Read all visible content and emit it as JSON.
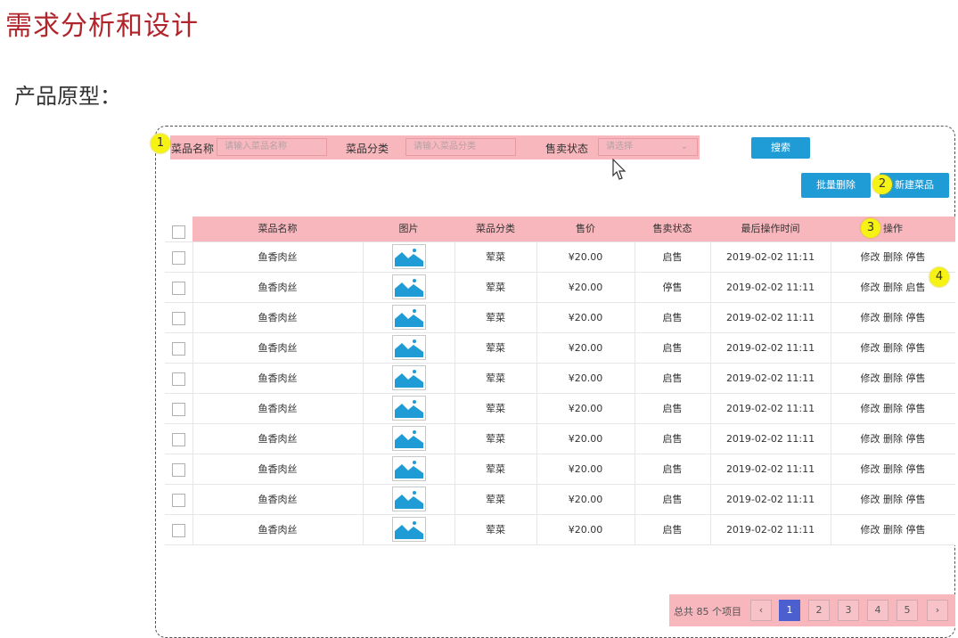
{
  "slide": {
    "title": "需求分析和设计",
    "subtitle": "产品原型："
  },
  "markers": [
    "1",
    "2",
    "3",
    "4"
  ],
  "search": {
    "name_label": "菜品名称",
    "name_placeholder": "请输入菜品名称",
    "category_label": "菜品分类",
    "category_placeholder": "请输入菜品分类",
    "status_label": "售卖状态",
    "status_placeholder": "请选择",
    "search_button": "搜索"
  },
  "actions": {
    "batch_delete": "批量删除",
    "new_dish": "新建菜品"
  },
  "table": {
    "columns": [
      "菜品名称",
      "图片",
      "菜品分类",
      "售价",
      "售卖状态",
      "最后操作时间",
      "操作"
    ],
    "rows": [
      {
        "name": "鱼香肉丝",
        "category": "荤菜",
        "price": "¥20.00",
        "status": "启售",
        "time": "2019-02-02 11:11",
        "edit": "修改",
        "delete": "删除",
        "toggle": "停售"
      },
      {
        "name": "鱼香肉丝",
        "category": "荤菜",
        "price": "¥20.00",
        "status": "停售",
        "time": "2019-02-02 11:11",
        "edit": "修改",
        "delete": "删除",
        "toggle": "启售"
      },
      {
        "name": "鱼香肉丝",
        "category": "荤菜",
        "price": "¥20.00",
        "status": "启售",
        "time": "2019-02-02 11:11",
        "edit": "修改",
        "delete": "删除",
        "toggle": "停售"
      },
      {
        "name": "鱼香肉丝",
        "category": "荤菜",
        "price": "¥20.00",
        "status": "启售",
        "time": "2019-02-02 11:11",
        "edit": "修改",
        "delete": "删除",
        "toggle": "停售"
      },
      {
        "name": "鱼香肉丝",
        "category": "荤菜",
        "price": "¥20.00",
        "status": "启售",
        "time": "2019-02-02 11:11",
        "edit": "修改",
        "delete": "删除",
        "toggle": "停售"
      },
      {
        "name": "鱼香肉丝",
        "category": "荤菜",
        "price": "¥20.00",
        "status": "启售",
        "time": "2019-02-02 11:11",
        "edit": "修改",
        "delete": "删除",
        "toggle": "停售"
      },
      {
        "name": "鱼香肉丝",
        "category": "荤菜",
        "price": "¥20.00",
        "status": "启售",
        "time": "2019-02-02 11:11",
        "edit": "修改",
        "delete": "删除",
        "toggle": "停售"
      },
      {
        "name": "鱼香肉丝",
        "category": "荤菜",
        "price": "¥20.00",
        "status": "启售",
        "time": "2019-02-02 11:11",
        "edit": "修改",
        "delete": "删除",
        "toggle": "停售"
      },
      {
        "name": "鱼香肉丝",
        "category": "荤菜",
        "price": "¥20.00",
        "status": "启售",
        "time": "2019-02-02 11:11",
        "edit": "修改",
        "delete": "删除",
        "toggle": "停售"
      },
      {
        "name": "鱼香肉丝",
        "category": "荤菜",
        "price": "¥20.00",
        "status": "启售",
        "time": "2019-02-02 11:11",
        "edit": "修改",
        "delete": "删除",
        "toggle": "停售"
      }
    ]
  },
  "pagination": {
    "total_text": "总共 85 个项目",
    "prev": "‹",
    "pages": [
      "1",
      "2",
      "3",
      "4",
      "5"
    ],
    "next": "›"
  },
  "colors": {
    "title_red": "#b0252b",
    "highlight_pink": "#f7b7bd",
    "button_blue": "#1f9bd6",
    "active_page": "#4b5fcf",
    "marker_yellow": "#f5f214"
  }
}
